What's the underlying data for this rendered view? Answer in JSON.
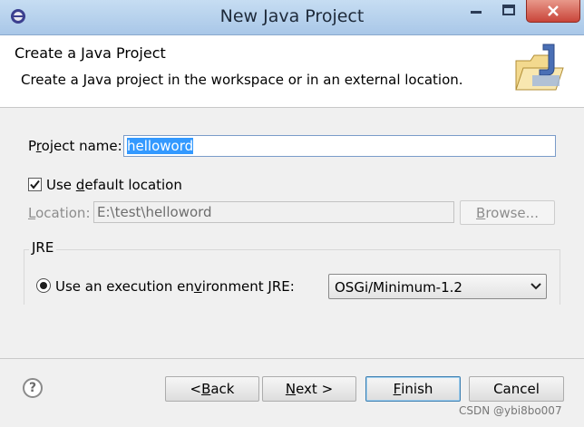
{
  "window": {
    "title": "New Java Project"
  },
  "header": {
    "title": "Create a Java Project",
    "description": "Create a Java project in the workspace or in an external location."
  },
  "form": {
    "project_name_label_pre": "P",
    "project_name_label_accel": "r",
    "project_name_label_post": "oject name:",
    "project_name_value": "helloword",
    "use_default_pre": "Use ",
    "use_default_accel": "d",
    "use_default_post": "efault location",
    "use_default_checked": true,
    "location_label_accel": "L",
    "location_label_post": "ocation:",
    "location_value": "E:\\test\\helloword",
    "browse_pre": "B",
    "browse_post": "rowse..."
  },
  "jre": {
    "group_label": "JRE",
    "exec_env_pre": "Use an execution en",
    "exec_env_accel": "v",
    "exec_env_post": "ironment JRE:",
    "exec_env_selected": true,
    "exec_env_value": "OSGi/Minimum-1.2"
  },
  "buttons": {
    "back_pre": "< ",
    "back_accel": "B",
    "back_post": "ack",
    "next_accel": "N",
    "next_post": "ext >",
    "finish_accel": "F",
    "finish_post": "inish",
    "cancel": "Cancel"
  },
  "help": {
    "glyph": "?"
  },
  "watermark": "CSDN @ybi8bo007",
  "colors": {
    "accent": "#3399ff",
    "title_bar": "#b7d3ef",
    "close_button": "#c9453a"
  }
}
